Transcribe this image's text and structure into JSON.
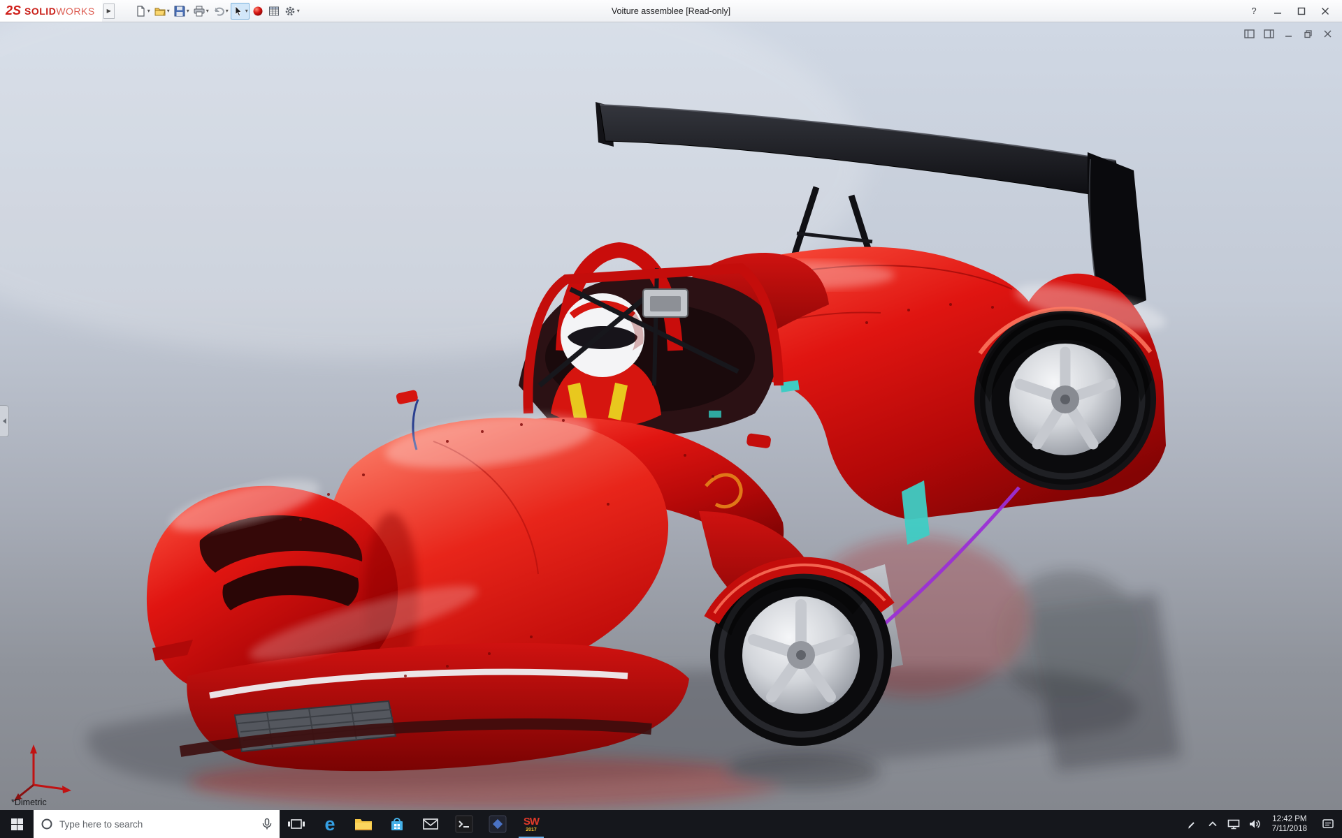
{
  "titlebar": {
    "logo_mark": "2S",
    "brand_solid": "SOLID",
    "brand_works": "WORKS",
    "flyout_arrow": "▶",
    "caret": "▾",
    "title": "Voiture assemblee [Read-only]",
    "help_label": "?"
  },
  "toolbar": {
    "icons": [
      {
        "name": "new-document"
      },
      {
        "name": "open-folder"
      },
      {
        "name": "save"
      },
      {
        "name": "print"
      },
      {
        "name": "undo"
      },
      {
        "name": "select-arrow",
        "active": true
      },
      {
        "name": "appearance-sphere"
      },
      {
        "name": "design-table"
      },
      {
        "name": "options-gear"
      }
    ]
  },
  "viewport": {
    "view_label": "*Dimetric",
    "scene_subject": "Red prototype race car assembly with black rear wing and helmeted driver"
  },
  "taskbar": {
    "search_placeholder": "Type here to search",
    "edge_glyph": "e",
    "solidworks_label": "SW",
    "solidworks_year": "2017",
    "clock_time": "12:42 PM",
    "clock_date": "7/11/2018"
  },
  "colors": {
    "car_red": "#d8100e",
    "wing_black": "#111114",
    "rim_silver": "#c9ccd2",
    "accent_purple": "#9b2fd6",
    "accent_teal": "#3fccc4",
    "taskbar_bg": "#15171c"
  }
}
